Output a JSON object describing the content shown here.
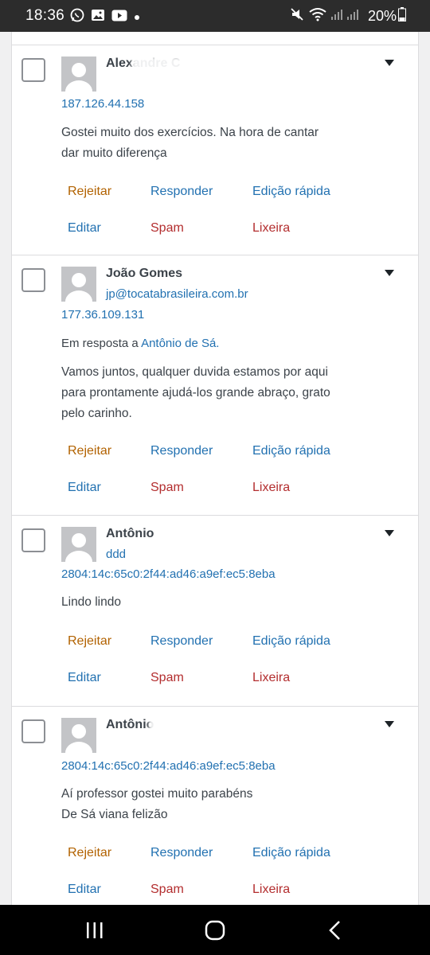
{
  "status_bar": {
    "time": "18:36",
    "battery": "20%"
  },
  "actions": {
    "approve": "Rejeitar",
    "reply": "Responder",
    "quick_edit": "Edição rápida",
    "edit": "Editar",
    "spam": "Spam",
    "trash": "Lixeira"
  },
  "comments": [
    {
      "author": "Alexandre C",
      "email": "",
      "ip": "187.126.44.158",
      "text_lines": [
        "Gostei muito dos exercícios. Na hora de cantar",
        "dar muito diferença"
      ]
    },
    {
      "author": "João Gomes",
      "email": "jp@tocatabrasileira.com.br",
      "ip": "177.36.109.131",
      "in_reply_prefix": "Em resposta a ",
      "in_reply_link": "Antônio de Sá.",
      "text_lines": [
        "Vamos juntos, qualquer duvida estamos por aqui",
        "para prontamente ajudá-los grande abraço, grato",
        "pelo carinho."
      ]
    },
    {
      "author": "Antônio",
      "email": "ddd",
      "ip": "2804:14c:65c0:2f44:ad46:a9ef:ec5:8eba",
      "text_lines": [
        "Lindo lindo"
      ]
    },
    {
      "author": "Antônio",
      "email": "",
      "ip": "2804:14c:65c0:2f44:ad46:a9ef:ec5:8eba",
      "text_lines": [
        "Aí professor gostei muito parabéns",
        "De Sá viana felizão"
      ]
    }
  ],
  "colors": {
    "link": "#2271b1",
    "approve": "#b26200",
    "danger": "#b32d2e"
  }
}
